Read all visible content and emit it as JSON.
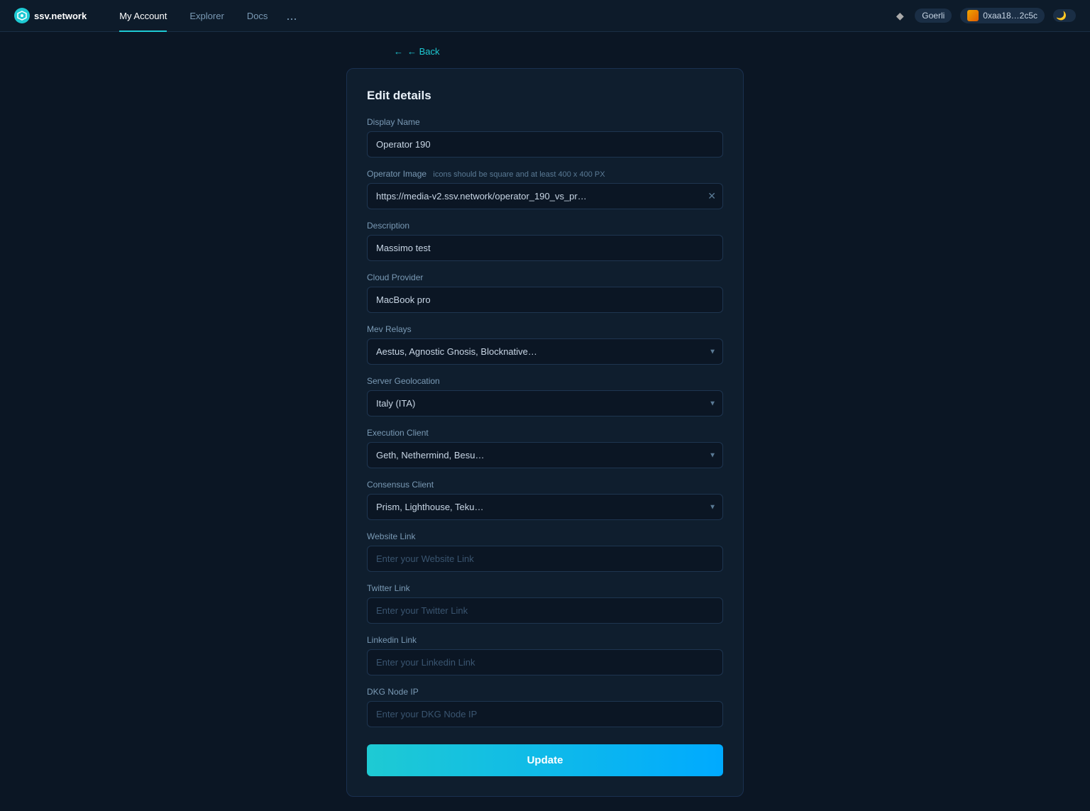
{
  "app": {
    "logo_text": "ssv.network",
    "logo_symbol": "◈"
  },
  "navbar": {
    "my_account_label": "My Account",
    "explorer_label": "Explorer",
    "docs_label": "Docs",
    "more_label": "...",
    "eth_icon": "◆",
    "network_badge": "Goerli",
    "wallet_address": "0xaa18…2c5c",
    "theme_icon": "🌙"
  },
  "back_link": {
    "label": "← Back"
  },
  "form": {
    "title": "Edit details",
    "fields": {
      "display_name": {
        "label": "Display Name",
        "value": "Operator 190",
        "placeholder": "Operator 190"
      },
      "operator_image": {
        "label": "Operator Image",
        "hint": "icons should be square and at least 400 x 400 PX",
        "value": "https://media-v2.ssv.network/operator_190_vs_pr…",
        "placeholder": "https://media-v2.ssv.network/operator_190_vs_pr…"
      },
      "description": {
        "label": "Description",
        "value": "Massimo test",
        "placeholder": ""
      },
      "cloud_provider": {
        "label": "Cloud Provider",
        "value": "MacBook pro",
        "placeholder": ""
      },
      "mev_relays": {
        "label": "Mev Relays",
        "value": "",
        "placeholder": "Aestus, Agnostic Gnosis, Blocknative…"
      },
      "server_geolocation": {
        "label": "Server Geolocation",
        "value": "Italy (ITA)",
        "placeholder": "Italy (ITA)"
      },
      "execution_client": {
        "label": "Execution Client",
        "value": "",
        "placeholder": "Geth, Nethermind, Besu…"
      },
      "consensus_client": {
        "label": "Consensus Client",
        "value": "",
        "placeholder": "Prism, Lighthouse, Teku…"
      },
      "website_link": {
        "label": "Website Link",
        "value": "",
        "placeholder": "Enter your Website Link"
      },
      "twitter_link": {
        "label": "Twitter Link",
        "value": "",
        "placeholder": "Enter your Twitter Link"
      },
      "linkedin_link": {
        "label": "Linkedin Link",
        "value": "",
        "placeholder": "Enter your Linkedin Link"
      },
      "dkg_node_ip": {
        "label": "DKG Node IP",
        "value": "",
        "placeholder": "Enter your DKG Node IP"
      }
    },
    "update_button_label": "Update"
  }
}
